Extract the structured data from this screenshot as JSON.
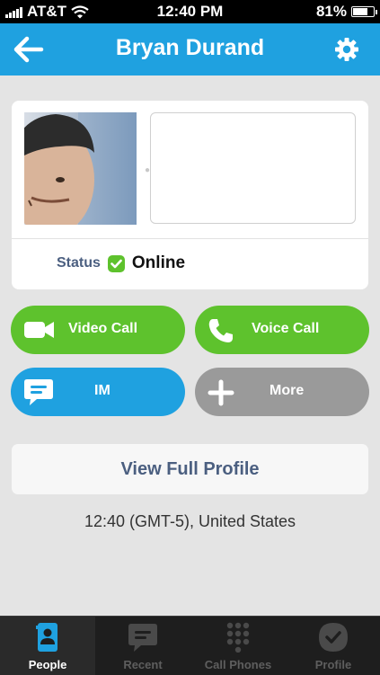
{
  "status_bar": {
    "carrier": "AT&T",
    "time": "12:40 PM",
    "battery": "81%",
    "battery_level": 0.81
  },
  "header": {
    "title": "Bryan Durand"
  },
  "profile": {
    "status_label": "Status",
    "status_value": "Online",
    "status_color": "#5ec22d"
  },
  "actions": {
    "video_call": "Video Call",
    "voice_call": "Voice Call",
    "im": "IM",
    "more": "More"
  },
  "view_profile": "View Full Profile",
  "local_time": "12:40 (GMT-5), United States",
  "tabs": [
    {
      "label": "People",
      "icon": "people-icon",
      "active": true
    },
    {
      "label": "Recent",
      "icon": "chat-bubble-icon"
    },
    {
      "label": "Call Phones",
      "icon": "dialpad-icon"
    },
    {
      "label": "Profile",
      "icon": "profile-check-icon"
    }
  ],
  "colors": {
    "accent": "#1fa1e0",
    "green": "#5ec22d",
    "grey": "#9a9a9a"
  }
}
